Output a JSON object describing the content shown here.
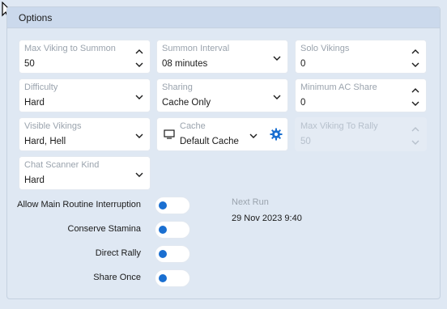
{
  "panel": {
    "title": "Options"
  },
  "fields": {
    "max_viking_to_summon": {
      "label": "Max Viking to Summon",
      "value": "50"
    },
    "summon_interval": {
      "label": "Summon Interval",
      "value": "08 minutes"
    },
    "solo_vikings": {
      "label": "Solo Vikings",
      "value": "0"
    },
    "difficulty": {
      "label": "Difficulty",
      "value": "Hard"
    },
    "sharing": {
      "label": "Sharing",
      "value": "Cache Only"
    },
    "minimum_ac_share": {
      "label": "Minimum AC Share",
      "value": "0"
    },
    "visible_vikings": {
      "label": "Visible Vikings",
      "value": "Hard, Hell"
    },
    "cache": {
      "label": "Cache",
      "value": "Default Cache"
    },
    "max_viking_to_rally": {
      "label": "Max Viking To Rally",
      "value": "50"
    },
    "chat_scanner_kind": {
      "label": "Chat Scanner Kind",
      "value": "Hard"
    }
  },
  "toggles": {
    "allow_main_routine_interruption": {
      "label": "Allow Main Routine Interruption",
      "on": false
    },
    "conserve_stamina": {
      "label": "Conserve Stamina",
      "on": false
    },
    "direct_rally": {
      "label": "Direct Rally",
      "on": false
    },
    "share_once": {
      "label": "Share Once",
      "on": false
    }
  },
  "next_run": {
    "label": "Next Run",
    "value": "29 Nov 2023 9:40"
  },
  "colors": {
    "accent": "#1a6fd1",
    "background": "#dfe8f3",
    "header": "#cbd9ec"
  },
  "icons": [
    "cursor-arrow-icon",
    "chevron-up-icon",
    "chevron-down-icon",
    "monitor-icon",
    "gear-icon"
  ]
}
